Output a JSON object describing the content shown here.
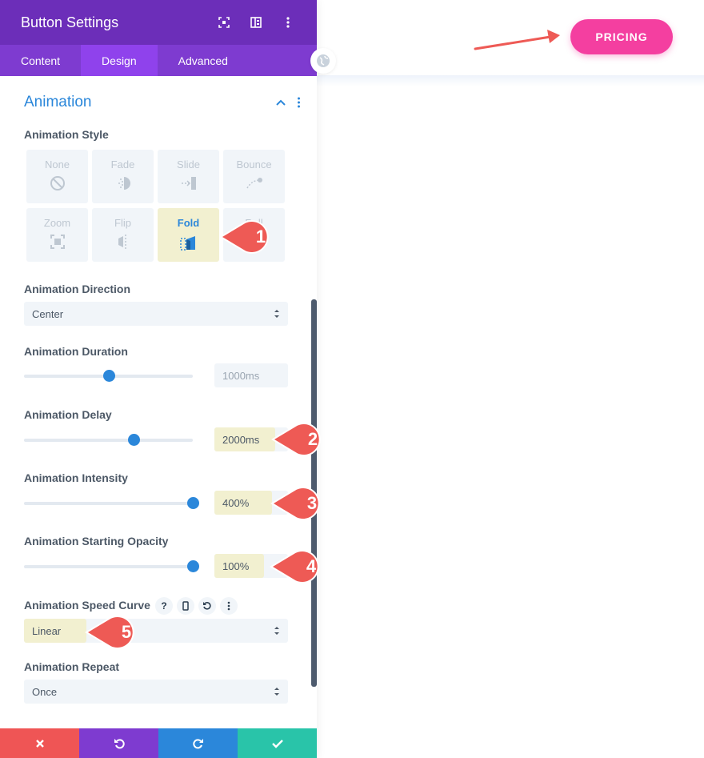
{
  "header": {
    "title": "Button Settings"
  },
  "tabs": [
    {
      "label": "Content"
    },
    {
      "label": "Design"
    },
    {
      "label": "Advanced"
    }
  ],
  "section": {
    "title": "Animation"
  },
  "animation_style": {
    "label": "Animation Style",
    "options": [
      {
        "label": "None",
        "icon": "none-icon"
      },
      {
        "label": "Fade",
        "icon": "fade-icon"
      },
      {
        "label": "Slide",
        "icon": "slide-icon"
      },
      {
        "label": "Bounce",
        "icon": "bounce-icon"
      },
      {
        "label": "Zoom",
        "icon": "zoom-icon"
      },
      {
        "label": "Flip",
        "icon": "flip-icon"
      },
      {
        "label": "Fold",
        "icon": "fold-icon",
        "selected": true
      },
      {
        "label": "Roll",
        "icon": "roll-icon"
      }
    ]
  },
  "direction": {
    "label": "Animation Direction",
    "value": "Center"
  },
  "duration": {
    "label": "Animation Duration",
    "value": "1000ms",
    "slider_fraction": 0.5
  },
  "delay": {
    "label": "Animation Delay",
    "value": "2000ms",
    "slider_fraction": 0.65
  },
  "intensity": {
    "label": "Animation Intensity",
    "value": "400%",
    "slider_fraction": 1.0
  },
  "opacity": {
    "label": "Animation Starting Opacity",
    "value": "100%",
    "slider_fraction": 1.0
  },
  "speed_curve": {
    "label": "Animation Speed Curve",
    "value": "Linear",
    "help": "?"
  },
  "repeat": {
    "label": "Animation Repeat",
    "value": "Once"
  },
  "preview": {
    "button_label": "PRICING"
  },
  "callouts": [
    "1",
    "2",
    "3",
    "4",
    "5"
  ],
  "colors": {
    "header": "#6c2eb9",
    "tabs": "#7e3bd0",
    "accent": "#2b87da",
    "highlight": "#f2f0d0",
    "callout": "#ee5a55",
    "pricing": "#f43fa0",
    "cancel": "#ef5555",
    "undo": "#7e3bd0",
    "redo": "#2b87da",
    "save": "#29c4a9"
  }
}
